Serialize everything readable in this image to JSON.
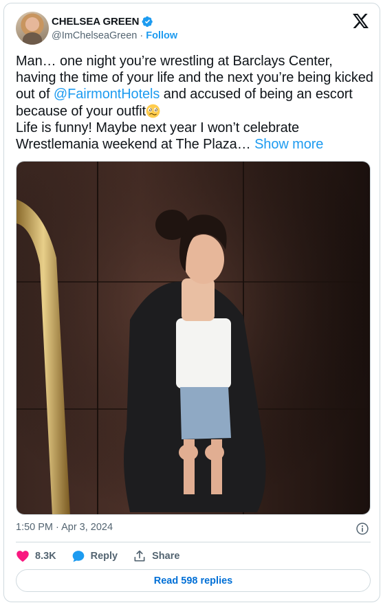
{
  "author": {
    "display_name": "CHELSEA GREEN",
    "handle": "@ImChelseaGreen",
    "separator": "·",
    "follow_label": "Follow",
    "verified": true
  },
  "tweet": {
    "text_part1": "Man… one night you’re wrestling at Barclays Center, having the time of your life and the next you’re being kicked out of ",
    "mention": "@FairmontHotels",
    "text_part2": " and accused of being an escort because of your outfit",
    "emoji": "woozy-face-icon",
    "text_part3": "Life is funny! Maybe next year I won’t celebrate Wrestlemania weekend at The Plaza… ",
    "show_more_label": "Show more"
  },
  "meta": {
    "timestamp": "1:50 PM · Apr 3, 2024"
  },
  "actions": {
    "likes_count": "8.3K",
    "reply_label": "Reply",
    "share_label": "Share"
  },
  "footer": {
    "read_replies_label": "Read 598 replies"
  },
  "colors": {
    "accent": "#1d9bf0",
    "like": "#f91880",
    "muted": "#536471",
    "border": "#cfd9de"
  }
}
